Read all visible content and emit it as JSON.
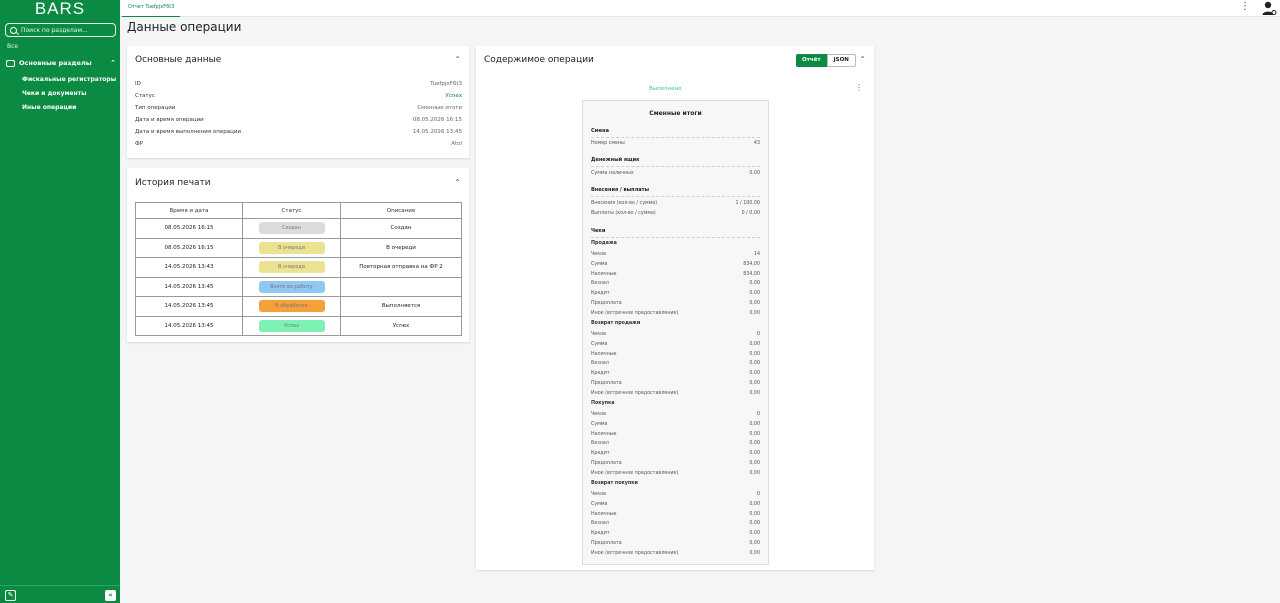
{
  "sidebar": {
    "brand": "BARS",
    "search_placeholder": "Поиск по разделам...",
    "all_label": "Все",
    "group_label": "Основные разделы",
    "items": [
      "Фискальные регистраторы",
      "Чеки и документы",
      "Иные операции"
    ]
  },
  "topbar": {
    "tab_label": "Отчет TuefpjxF6t3"
  },
  "page_title": "Данные операции",
  "main_data": {
    "title": "Основные данные",
    "rows": [
      {
        "label": "ID",
        "value": "TuefpjxF6t3"
      },
      {
        "label": "Статус",
        "value": "Успех"
      },
      {
        "label": "Тип операции",
        "value": "Сменные итоги"
      },
      {
        "label": "Дата и время операции",
        "value": "08.05.2026 16:15"
      },
      {
        "label": "Дата и время выполнения операции",
        "value": "14.05.2026 13:45"
      },
      {
        "label": "ФР",
        "value": "Atol"
      }
    ]
  },
  "print_history": {
    "title": "История печати",
    "headers": [
      "Время и дата",
      "Статус",
      "Описание"
    ],
    "rows": [
      {
        "time": "08.05.2026 16:15",
        "status": "Создан",
        "color": "#dcdcdc",
        "desc": "Создан"
      },
      {
        "time": "08.05.2026 16:15",
        "status": "В очереди",
        "color": "#ece392",
        "desc": "В очереди"
      },
      {
        "time": "14.05.2026 13:43",
        "status": "В очереди",
        "color": "#ece392",
        "desc": "Повторная отправка на ФР 2"
      },
      {
        "time": "14.05.2026 13:45",
        "status": "Взято во работу",
        "color": "#90c8f5",
        "desc": ""
      },
      {
        "time": "14.05.2026 13:45",
        "status": "В обработке",
        "color": "#f6a03a",
        "desc": "Выполняется"
      },
      {
        "time": "14.05.2026 13:45",
        "status": "Успех",
        "color": "#7ef2b4",
        "desc": "Успех"
      }
    ]
  },
  "content": {
    "title": "Содержимое операции",
    "toggle_report": "Отчёт",
    "toggle_json": "JSON",
    "status_text": "Выполнено",
    "receipt": {
      "title": "Сменные итоги",
      "shift_section": "Смена",
      "shift_number_label": "Номер смены",
      "shift_number": "43",
      "cash_section": "Денежный ящик",
      "cash_sum_label": "Сумма наличных",
      "cash_sum": "0,00",
      "io_section": "Внесения / выплаты",
      "deposits_label": "Внесения (кол-во / сумма)",
      "deposits": "1 / 100,00",
      "payouts_label": "Выплаты (кол-во / сумма)",
      "payouts": "0 / 0,00",
      "checks_section": "Чеки",
      "field_labels": [
        "Чеков",
        "Сумма",
        "Наличные",
        "Безнал",
        "Кредит",
        "Предоплата",
        "Иное (встречное предоставление)"
      ],
      "groups": [
        {
          "name": "Продажа",
          "values": [
            "14",
            "834,00",
            "834,00",
            "0,00",
            "0,00",
            "0,00",
            "0,00"
          ]
        },
        {
          "name": "Возврат продажи",
          "values": [
            "0",
            "0,00",
            "0,00",
            "0,00",
            "0,00",
            "0,00",
            "0,00"
          ]
        },
        {
          "name": "Покупка",
          "values": [
            "0",
            "0,00",
            "0,00",
            "0,00",
            "0,00",
            "0,00",
            "0,00"
          ]
        },
        {
          "name": "Возврат покупки",
          "values": [
            "0",
            "0,00",
            "0,00",
            "0,00",
            "0,00",
            "0,00",
            "0,00"
          ]
        }
      ]
    }
  }
}
